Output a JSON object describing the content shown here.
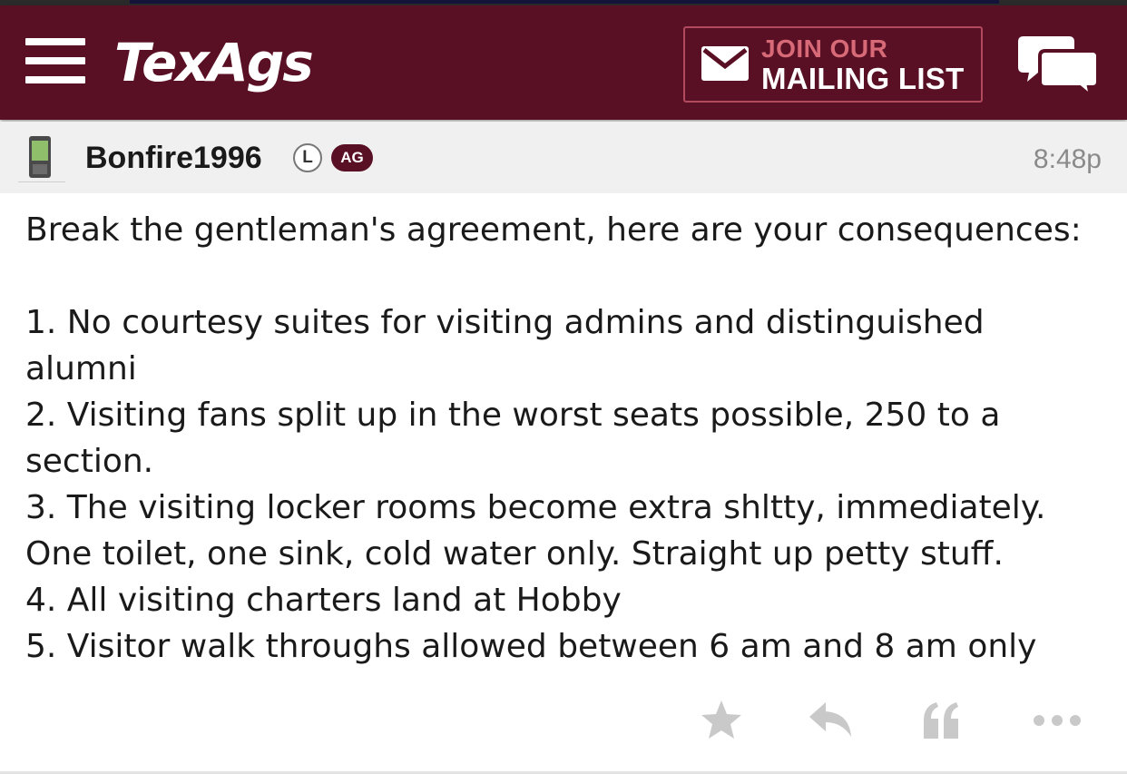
{
  "header": {
    "logo": "TexAgs",
    "mailing_line1": "JOIN OUR",
    "mailing_line2": "MAILING LIST",
    "colors": {
      "maroon": "#5a1024",
      "accent": "#d86a78"
    }
  },
  "post": {
    "username": "Bonfire1996",
    "badge_l": "L",
    "badge_ag": "AG",
    "time": "8:48p",
    "intro": "Break the gentleman's agreement, here are your consequences:",
    "lines": [
      "1. No courtesy suites for visiting admins and distinguished",
      "alumni",
      "2. Visiting fans split up in the worst seats possible, 250 to a",
      "section.",
      "3. The visiting locker rooms become extra shltty, immediately.",
      "One toilet, one sink, cold water only. Straight up petty stuff.",
      "4. All visiting charters land at Hobby",
      "5. Visitor walk throughs allowed between 6 am and 8 am only"
    ]
  },
  "icons": {
    "menu": "hamburger-menu-icon",
    "mail": "envelope-icon",
    "chat": "chat-bubbles-icon",
    "device": "mobile-phone-icon",
    "star": "star-icon",
    "reply": "reply-arrow-icon",
    "quote": "quote-icon",
    "more": "ellipsis-icon"
  }
}
